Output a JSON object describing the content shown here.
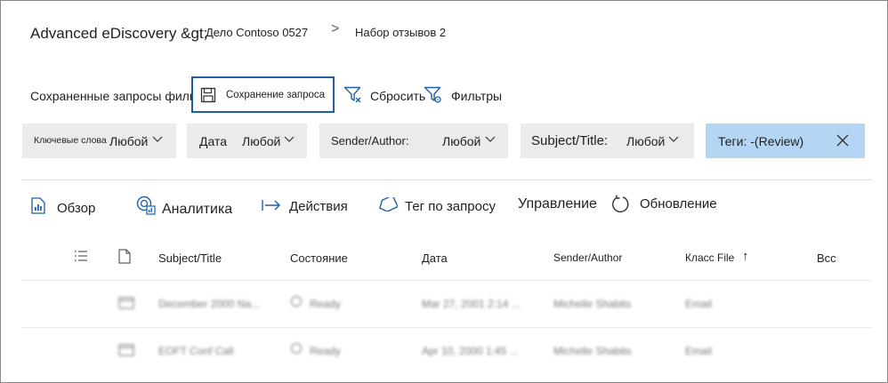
{
  "breadcrumb": {
    "root": "Advanced eDiscovery &gt;",
    "case": "Дело Contoso 0527",
    "separator": ">",
    "set": "Набор отзывов 2"
  },
  "saved_queries": {
    "label": "Сохраненные запросы фильтра",
    "save_label": "Сохранение запроса",
    "reset_label": "Сбросить",
    "filters_label": "Фильтры"
  },
  "filters": [
    {
      "label": "Ключевые слова",
      "value": "Любой"
    },
    {
      "label": "Дата",
      "value": "Любой"
    },
    {
      "label": "Sender/Author:",
      "value": "Любой"
    },
    {
      "label": "Subject/Title:",
      "value": "Любой"
    },
    {
      "label": "Теги: -(Review)",
      "value": ""
    }
  ],
  "commands": {
    "overview": "Обзор",
    "analytics": "Аналитика",
    "actions": "Действия",
    "tag_by_query": "Тег по запросу",
    "manage": "Управление",
    "refresh": "Обновление"
  },
  "table": {
    "headers": [
      "Subject/Title",
      "Состояние",
      "Дата",
      "Sender/Author",
      "Класс File",
      "Bcc"
    ],
    "sort_indicator": "↑",
    "rows": [
      {
        "subject": "December 2000 Na...",
        "status": "Ready",
        "date": "Mar 27, 2001 2:14 ...",
        "author": "Michelle Shabits",
        "class": "Email"
      },
      {
        "subject": "EOFT Conf Call",
        "status": "Ready",
        "date": "Apr 10, 2000 1:45 ...",
        "author": "Michelle Shabits",
        "class": "Email"
      }
    ]
  },
  "colors": {
    "accent": "#1f5fa8",
    "tag_chip": "#b4d6f4",
    "chip": "#edebe9"
  }
}
